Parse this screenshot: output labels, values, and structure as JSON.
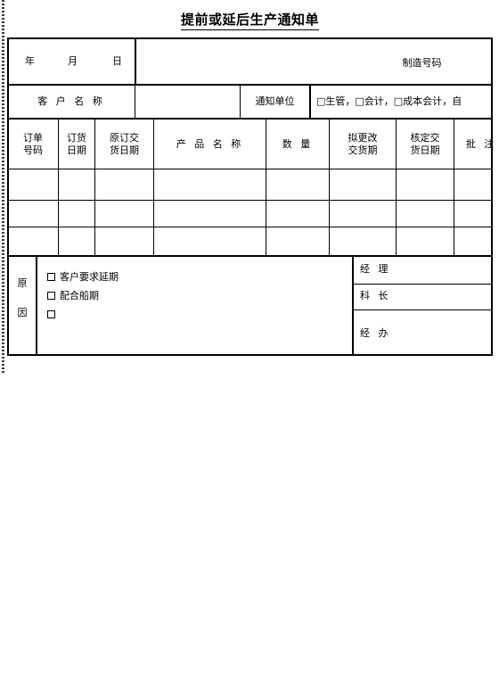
{
  "document": {
    "title": "提前或延后生产通知单"
  },
  "header": {
    "date_label": "年        月        日",
    "date_year": "年",
    "date_month": "月",
    "date_day": "日",
    "manufacture_no_label": "制造号码",
    "customer_name_label": "客  户  名  称",
    "customer_name_value": "",
    "notify_unit_label": "通知单位",
    "notify_unit_options": "□生管，□会计，□成本会计，自"
  },
  "table": {
    "columns": [
      {
        "label": "订单号码",
        "lines": [
          "订单",
          "号码"
        ]
      },
      {
        "label": "订货日期",
        "lines": [
          "订货",
          "日期"
        ]
      },
      {
        "label": "原订交货日期",
        "lines": [
          "原订交",
          "货日期"
        ]
      },
      {
        "label": "产品名称",
        "lines": [
          "产 品 名 称"
        ]
      },
      {
        "label": "数量",
        "lines": [
          "数    量"
        ]
      },
      {
        "label": "拟更改交货期",
        "lines": [
          "拟更改",
          "交货期"
        ]
      },
      {
        "label": "核定交货日期",
        "lines": [
          "核定交",
          "货日期"
        ]
      },
      {
        "label": "批注",
        "lines": [
          "批  注"
        ]
      }
    ],
    "rows": [
      [
        "",
        "",
        "",
        "",
        "",
        "",
        "",
        ""
      ],
      [
        "",
        "",
        "",
        "",
        "",
        "",
        "",
        ""
      ],
      [
        "",
        "",
        "",
        "",
        "",
        "",
        "",
        ""
      ]
    ]
  },
  "reason": {
    "label_char_1": "原",
    "label_char_2": "因",
    "options": [
      {
        "text": "客户要求延期",
        "checked": false
      },
      {
        "text": "配合船期",
        "checked": false
      },
      {
        "text": "",
        "checked": false
      }
    ]
  },
  "signatures": [
    {
      "label": "经  理",
      "value": ""
    },
    {
      "label": "科  长",
      "value": ""
    },
    {
      "label": "经  办",
      "value": ""
    }
  ]
}
